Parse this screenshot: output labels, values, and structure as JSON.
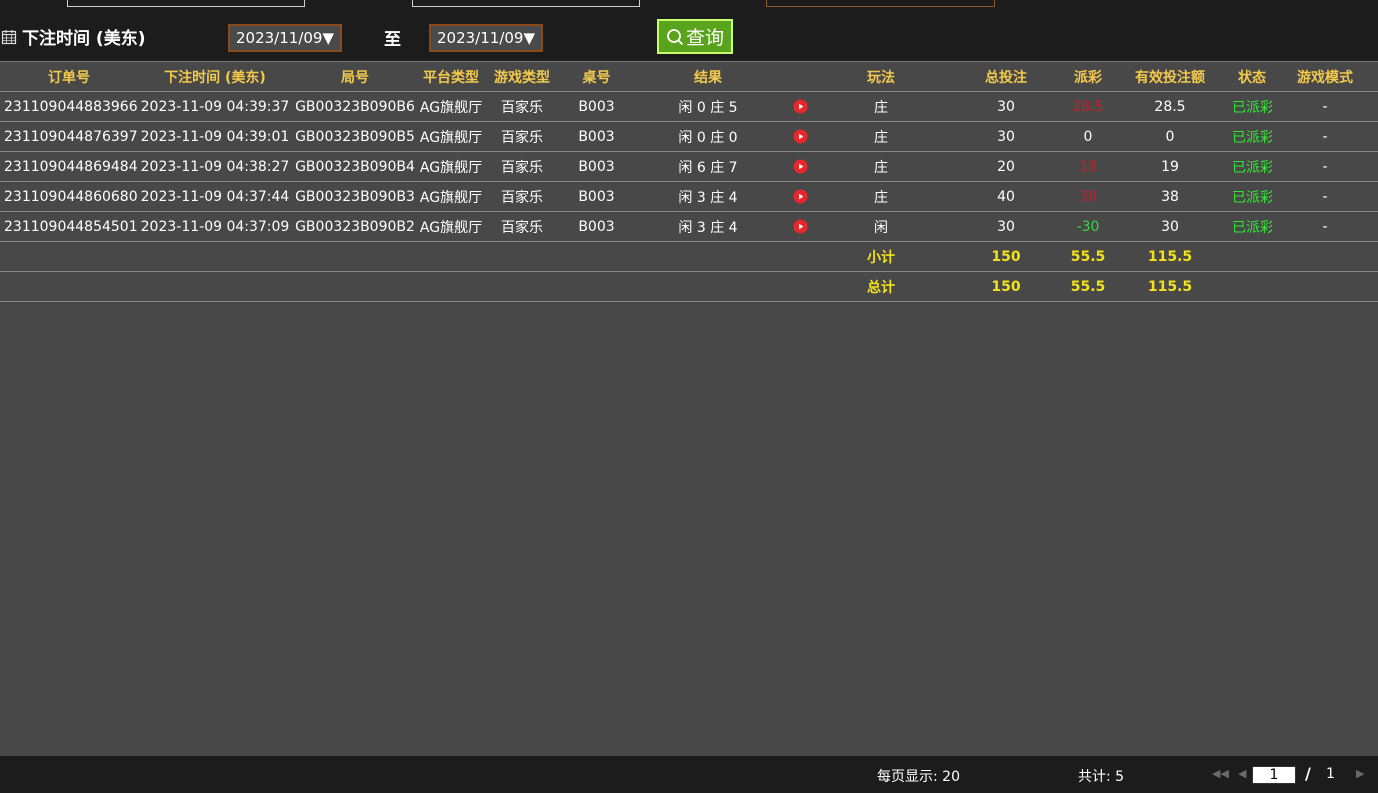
{
  "filter": {
    "label": "下注时间 (美东)",
    "start_date": "2023/11/09▼",
    "to_label": "至",
    "end_date": "2023/11/09▼",
    "query_label": "查询"
  },
  "table": {
    "headers": [
      "订单号",
      "下注时间 (美东)",
      "局号",
      "平台类型",
      "游戏类型",
      "桌号",
      "结果",
      "",
      "玩法",
      "总投注",
      "派彩",
      "有效投注额",
      "状态",
      "游戏模式"
    ],
    "rows": [
      {
        "order": "231109044883966",
        "time": "2023-11-09 04:39:37",
        "round": "GB00323B090B6",
        "platform": "AG旗舰厅",
        "game": "百家乐",
        "table_no": "B003",
        "result": "闲 0 庄 5",
        "play": "庄",
        "bet": "30",
        "payout": "28.5",
        "payout_color": "red",
        "valid": "28.5",
        "status": "已派彩",
        "mode": "-"
      },
      {
        "order": "231109044876397",
        "time": "2023-11-09 04:39:01",
        "round": "GB00323B090B5",
        "platform": "AG旗舰厅",
        "game": "百家乐",
        "table_no": "B003",
        "result": "闲 0 庄 0",
        "play": "庄",
        "bet": "30",
        "payout": "0",
        "payout_color": "white",
        "valid": "0",
        "status": "已派彩",
        "mode": "-"
      },
      {
        "order": "231109044869484",
        "time": "2023-11-09 04:38:27",
        "round": "GB00323B090B4",
        "platform": "AG旗舰厅",
        "game": "百家乐",
        "table_no": "B003",
        "result": "闲 6 庄 7",
        "play": "庄",
        "bet": "20",
        "payout": "19",
        "payout_color": "red",
        "valid": "19",
        "status": "已派彩",
        "mode": "-"
      },
      {
        "order": "231109044860680",
        "time": "2023-11-09 04:37:44",
        "round": "GB00323B090B3",
        "platform": "AG旗舰厅",
        "game": "百家乐",
        "table_no": "B003",
        "result": "闲 3 庄 4",
        "play": "庄",
        "bet": "40",
        "payout": "38",
        "payout_color": "red",
        "valid": "38",
        "status": "已派彩",
        "mode": "-"
      },
      {
        "order": "231109044854501",
        "time": "2023-11-09 04:37:09",
        "round": "GB00323B090B2",
        "platform": "AG旗舰厅",
        "game": "百家乐",
        "table_no": "B003",
        "result": "闲 3 庄 4",
        "play": "闲",
        "bet": "30",
        "payout": "-30",
        "payout_color": "green",
        "valid": "30",
        "status": "已派彩",
        "mode": "-"
      }
    ],
    "subtotal": {
      "label": "小计",
      "bet": "150",
      "payout": "55.5",
      "valid": "115.5"
    },
    "total": {
      "label": "总计",
      "bet": "150",
      "payout": "55.5",
      "valid": "115.5"
    }
  },
  "footer": {
    "per_page": "每页显示: 20",
    "total": "共计: 5",
    "current_page": "1",
    "slash": "/",
    "total_pages": "1"
  },
  "colors": {
    "header_text": "#f2c94c",
    "payout_red": "#c21f2c",
    "payout_green": "#38d24a",
    "status_green": "#33e833",
    "summary_text": "#f2e21a",
    "query_button": "#5aa31c"
  },
  "icons": {
    "calendar": "calendar-icon",
    "search": "search-icon",
    "play": "play-video-icon",
    "first": "first-page-icon",
    "prev": "prev-page-icon",
    "next": "next-page-icon"
  }
}
